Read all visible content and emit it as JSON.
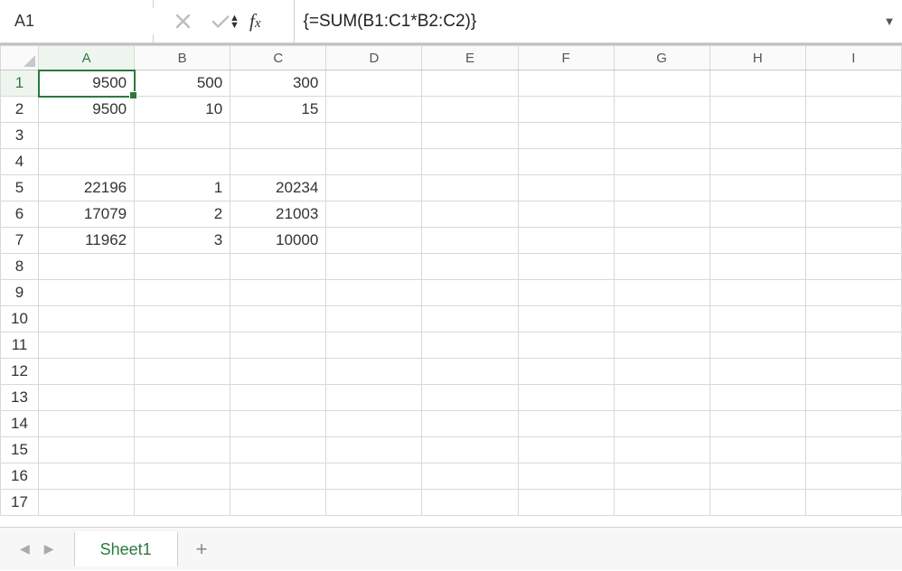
{
  "nameBox": "A1",
  "formula": "{=SUM(B1:C1*B2:C2)}",
  "columns": [
    "A",
    "B",
    "C",
    "D",
    "E",
    "F",
    "G",
    "H",
    "I"
  ],
  "rowCount": 17,
  "selected": {
    "row": 1,
    "col": "A"
  },
  "cells": {
    "A1": "9500",
    "B1": "500",
    "C1": "300",
    "A2": "9500",
    "B2": "10",
    "C2": "15",
    "A5": "22196",
    "B5": "1",
    "C5": "20234",
    "A6": "17079",
    "B6": "2",
    "C6": "21003",
    "A7": "11962",
    "B7": "3",
    "C7": "10000"
  },
  "sheetTab": "Sheet1"
}
